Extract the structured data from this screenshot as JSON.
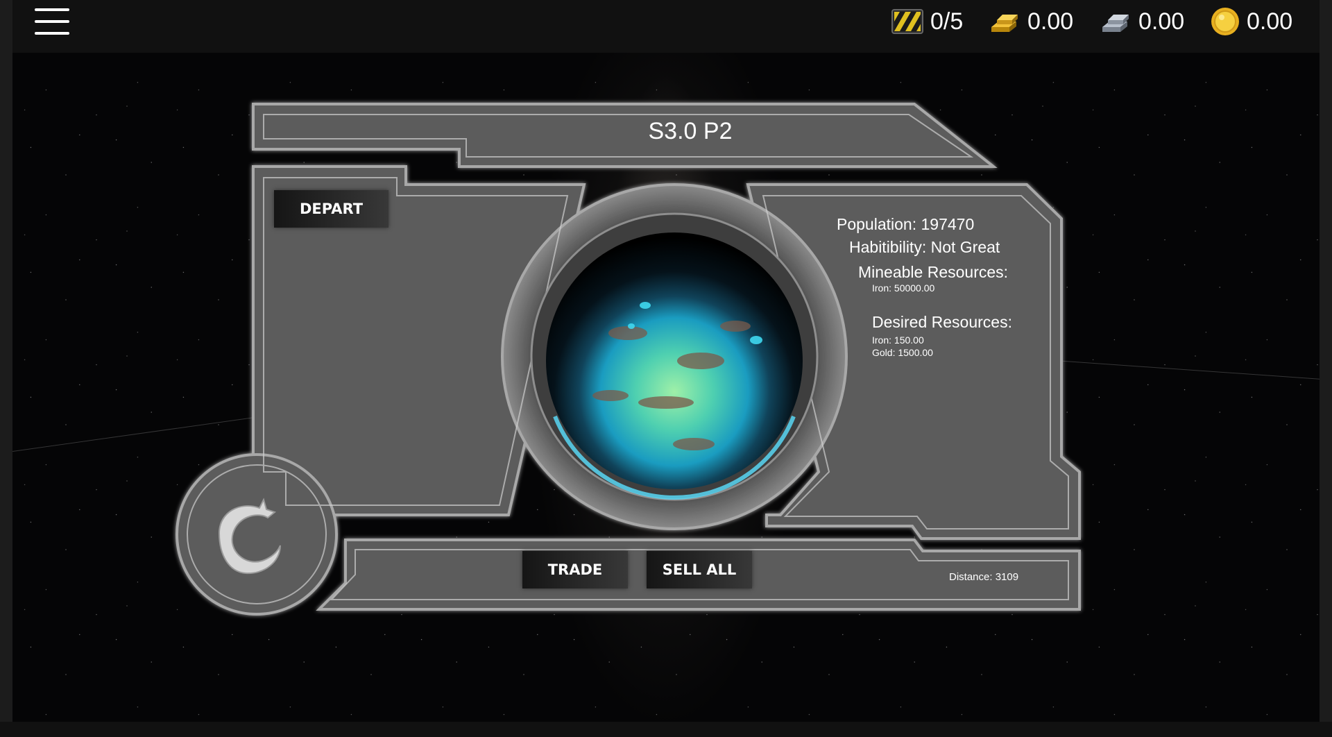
{
  "topbar": {
    "menu_icon": "hamburger-menu-icon",
    "resources": [
      {
        "icon": "cargo-hazard-icon",
        "value": "0/5"
      },
      {
        "icon": "gold-bars-icon",
        "value": "0.00"
      },
      {
        "icon": "iron-bars-icon",
        "value": "0.00"
      },
      {
        "icon": "coin-icon",
        "value": "0.00"
      }
    ]
  },
  "planet_panel": {
    "title": "S3.0 P2",
    "depart_label": "DEPART",
    "trade_label": "TRADE",
    "sell_all_label": "SELL ALL",
    "emblem_icon": "dragon-emblem-icon",
    "planet_icon": "ocean-planet-image",
    "population": "Population: 197470",
    "habitability": "Habitibility: Not Great",
    "mineable_heading": "Mineable Resources:",
    "mineable_items": [
      "Iron: 50000.00"
    ],
    "desired_heading": "Desired Resources:",
    "desired_items": [
      "Iron: 150.00",
      "Gold: 1500.00"
    ],
    "distance": "Distance: 3109"
  },
  "colors": {
    "panel_fill": "#5f5f5f",
    "panel_frame": "#9a9a9a",
    "button_dark": "#1a1a1a",
    "planet_ocean": "#20b8d8"
  }
}
